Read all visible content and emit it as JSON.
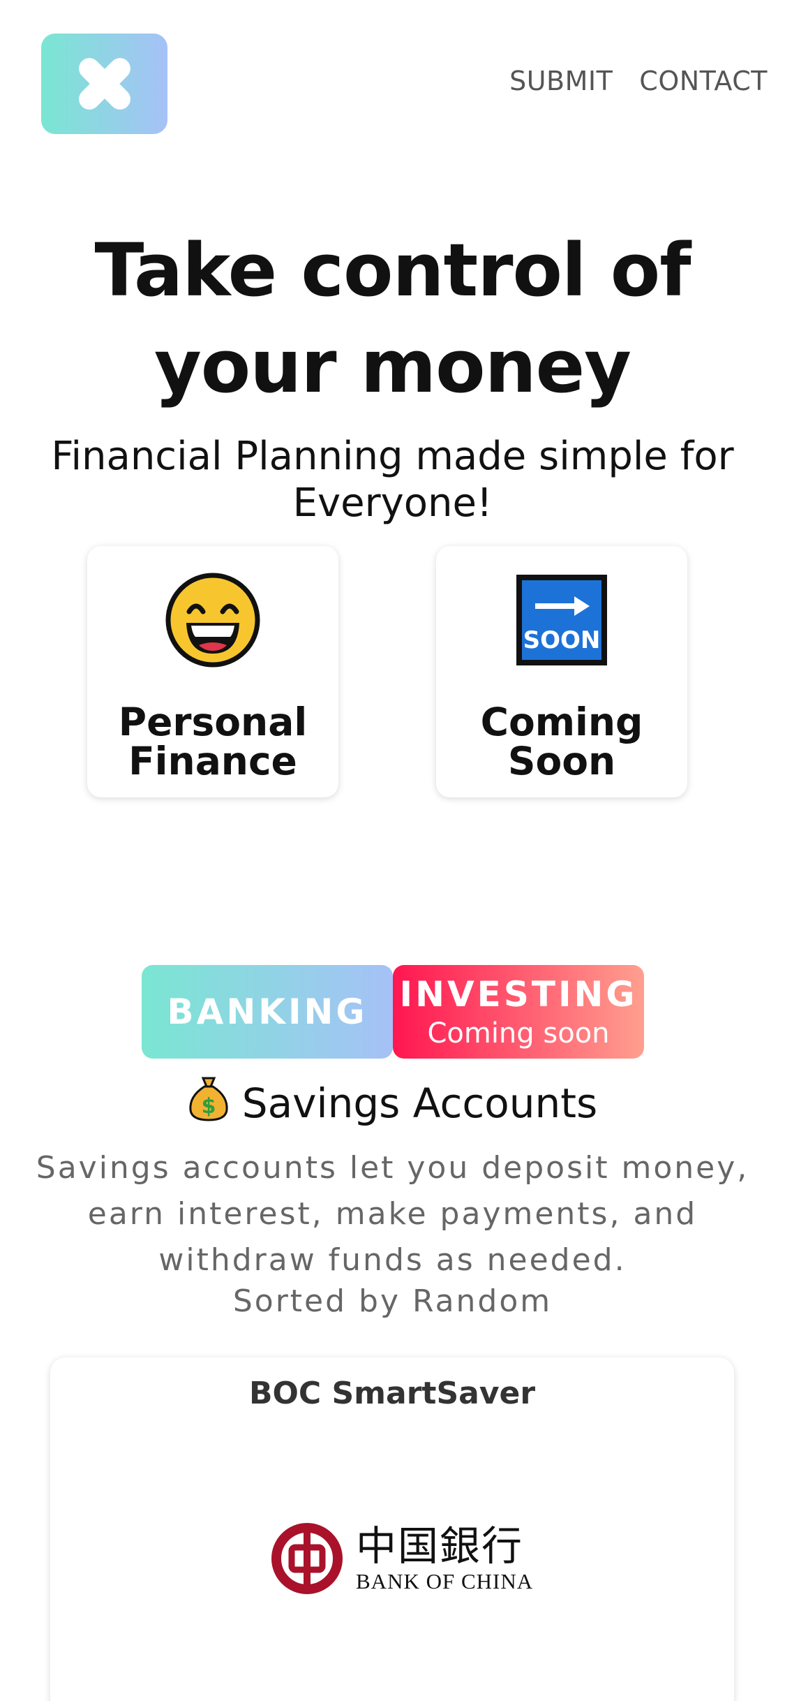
{
  "header": {
    "logo_icon": "close-x-icon",
    "nav": [
      {
        "label": "SUBMIT"
      },
      {
        "label": "CONTACT"
      }
    ]
  },
  "hero": {
    "title_line1": "Take control of",
    "title_line2": "your money",
    "subtitle": "Financial Planning made simple for Everyone!"
  },
  "categories": [
    {
      "label_line1": "Personal",
      "label_line2": "Finance",
      "icon": "grinning-face-icon"
    },
    {
      "label_line1": "Coming",
      "label_line2": "Soon",
      "icon": "soon-arrow-icon",
      "icon_text": "SOON"
    }
  ],
  "tabs": {
    "banking": {
      "label": "BANKING"
    },
    "investing": {
      "label": "INVESTING",
      "sublabel": "Coming soon"
    }
  },
  "section": {
    "icon": "money-bag-icon",
    "title": "Savings Accounts",
    "description": "Savings accounts let you deposit money, earn interest, make payments, and withdraw funds as needed.",
    "sorted_by": "Sorted by Random"
  },
  "accounts": [
    {
      "name": "BOC SmartSaver",
      "bank_logo_cn": "中国銀行",
      "bank_logo_en": "BANK OF CHINA"
    }
  ],
  "colors": {
    "teal_gradient_start": "#7ae6d2",
    "teal_gradient_end": "#a6c1f7",
    "red_gradient_start": "#ff1650",
    "red_gradient_end": "#ff9f8f",
    "boc_red": "#a9122a"
  }
}
